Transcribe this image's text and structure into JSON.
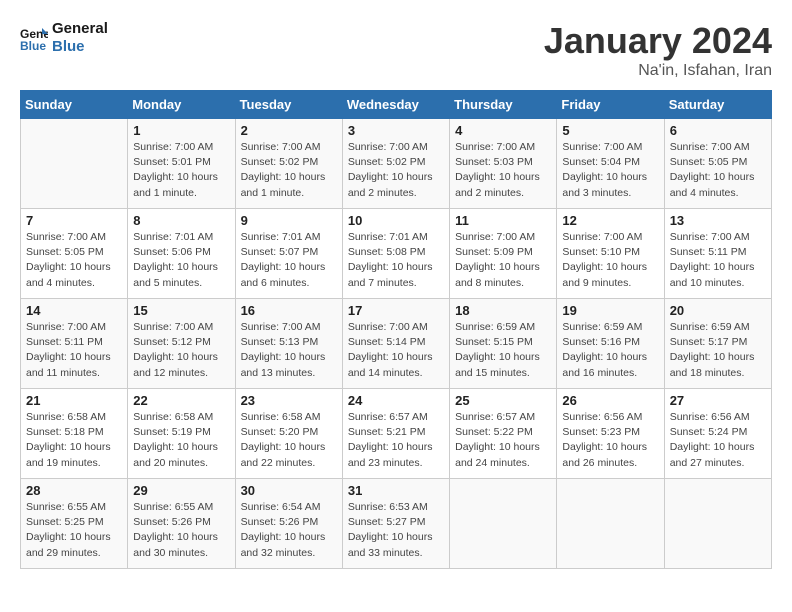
{
  "header": {
    "logo_line1": "General",
    "logo_line2": "Blue",
    "title": "January 2024",
    "subtitle": "Na'in, Isfahan, Iran"
  },
  "weekdays": [
    "Sunday",
    "Monday",
    "Tuesday",
    "Wednesday",
    "Thursday",
    "Friday",
    "Saturday"
  ],
  "weeks": [
    [
      {
        "day": "",
        "info": ""
      },
      {
        "day": "1",
        "info": "Sunrise: 7:00 AM\nSunset: 5:01 PM\nDaylight: 10 hours\nand 1 minute."
      },
      {
        "day": "2",
        "info": "Sunrise: 7:00 AM\nSunset: 5:02 PM\nDaylight: 10 hours\nand 1 minute."
      },
      {
        "day": "3",
        "info": "Sunrise: 7:00 AM\nSunset: 5:02 PM\nDaylight: 10 hours\nand 2 minutes."
      },
      {
        "day": "4",
        "info": "Sunrise: 7:00 AM\nSunset: 5:03 PM\nDaylight: 10 hours\nand 2 minutes."
      },
      {
        "day": "5",
        "info": "Sunrise: 7:00 AM\nSunset: 5:04 PM\nDaylight: 10 hours\nand 3 minutes."
      },
      {
        "day": "6",
        "info": "Sunrise: 7:00 AM\nSunset: 5:05 PM\nDaylight: 10 hours\nand 4 minutes."
      }
    ],
    [
      {
        "day": "7",
        "info": "Sunrise: 7:00 AM\nSunset: 5:05 PM\nDaylight: 10 hours\nand 4 minutes."
      },
      {
        "day": "8",
        "info": "Sunrise: 7:01 AM\nSunset: 5:06 PM\nDaylight: 10 hours\nand 5 minutes."
      },
      {
        "day": "9",
        "info": "Sunrise: 7:01 AM\nSunset: 5:07 PM\nDaylight: 10 hours\nand 6 minutes."
      },
      {
        "day": "10",
        "info": "Sunrise: 7:01 AM\nSunset: 5:08 PM\nDaylight: 10 hours\nand 7 minutes."
      },
      {
        "day": "11",
        "info": "Sunrise: 7:00 AM\nSunset: 5:09 PM\nDaylight: 10 hours\nand 8 minutes."
      },
      {
        "day": "12",
        "info": "Sunrise: 7:00 AM\nSunset: 5:10 PM\nDaylight: 10 hours\nand 9 minutes."
      },
      {
        "day": "13",
        "info": "Sunrise: 7:00 AM\nSunset: 5:11 PM\nDaylight: 10 hours\nand 10 minutes."
      }
    ],
    [
      {
        "day": "14",
        "info": "Sunrise: 7:00 AM\nSunset: 5:11 PM\nDaylight: 10 hours\nand 11 minutes."
      },
      {
        "day": "15",
        "info": "Sunrise: 7:00 AM\nSunset: 5:12 PM\nDaylight: 10 hours\nand 12 minutes."
      },
      {
        "day": "16",
        "info": "Sunrise: 7:00 AM\nSunset: 5:13 PM\nDaylight: 10 hours\nand 13 minutes."
      },
      {
        "day": "17",
        "info": "Sunrise: 7:00 AM\nSunset: 5:14 PM\nDaylight: 10 hours\nand 14 minutes."
      },
      {
        "day": "18",
        "info": "Sunrise: 6:59 AM\nSunset: 5:15 PM\nDaylight: 10 hours\nand 15 minutes."
      },
      {
        "day": "19",
        "info": "Sunrise: 6:59 AM\nSunset: 5:16 PM\nDaylight: 10 hours\nand 16 minutes."
      },
      {
        "day": "20",
        "info": "Sunrise: 6:59 AM\nSunset: 5:17 PM\nDaylight: 10 hours\nand 18 minutes."
      }
    ],
    [
      {
        "day": "21",
        "info": "Sunrise: 6:58 AM\nSunset: 5:18 PM\nDaylight: 10 hours\nand 19 minutes."
      },
      {
        "day": "22",
        "info": "Sunrise: 6:58 AM\nSunset: 5:19 PM\nDaylight: 10 hours\nand 20 minutes."
      },
      {
        "day": "23",
        "info": "Sunrise: 6:58 AM\nSunset: 5:20 PM\nDaylight: 10 hours\nand 22 minutes."
      },
      {
        "day": "24",
        "info": "Sunrise: 6:57 AM\nSunset: 5:21 PM\nDaylight: 10 hours\nand 23 minutes."
      },
      {
        "day": "25",
        "info": "Sunrise: 6:57 AM\nSunset: 5:22 PM\nDaylight: 10 hours\nand 24 minutes."
      },
      {
        "day": "26",
        "info": "Sunrise: 6:56 AM\nSunset: 5:23 PM\nDaylight: 10 hours\nand 26 minutes."
      },
      {
        "day": "27",
        "info": "Sunrise: 6:56 AM\nSunset: 5:24 PM\nDaylight: 10 hours\nand 27 minutes."
      }
    ],
    [
      {
        "day": "28",
        "info": "Sunrise: 6:55 AM\nSunset: 5:25 PM\nDaylight: 10 hours\nand 29 minutes."
      },
      {
        "day": "29",
        "info": "Sunrise: 6:55 AM\nSunset: 5:26 PM\nDaylight: 10 hours\nand 30 minutes."
      },
      {
        "day": "30",
        "info": "Sunrise: 6:54 AM\nSunset: 5:26 PM\nDaylight: 10 hours\nand 32 minutes."
      },
      {
        "day": "31",
        "info": "Sunrise: 6:53 AM\nSunset: 5:27 PM\nDaylight: 10 hours\nand 33 minutes."
      },
      {
        "day": "",
        "info": ""
      },
      {
        "day": "",
        "info": ""
      },
      {
        "day": "",
        "info": ""
      }
    ]
  ]
}
